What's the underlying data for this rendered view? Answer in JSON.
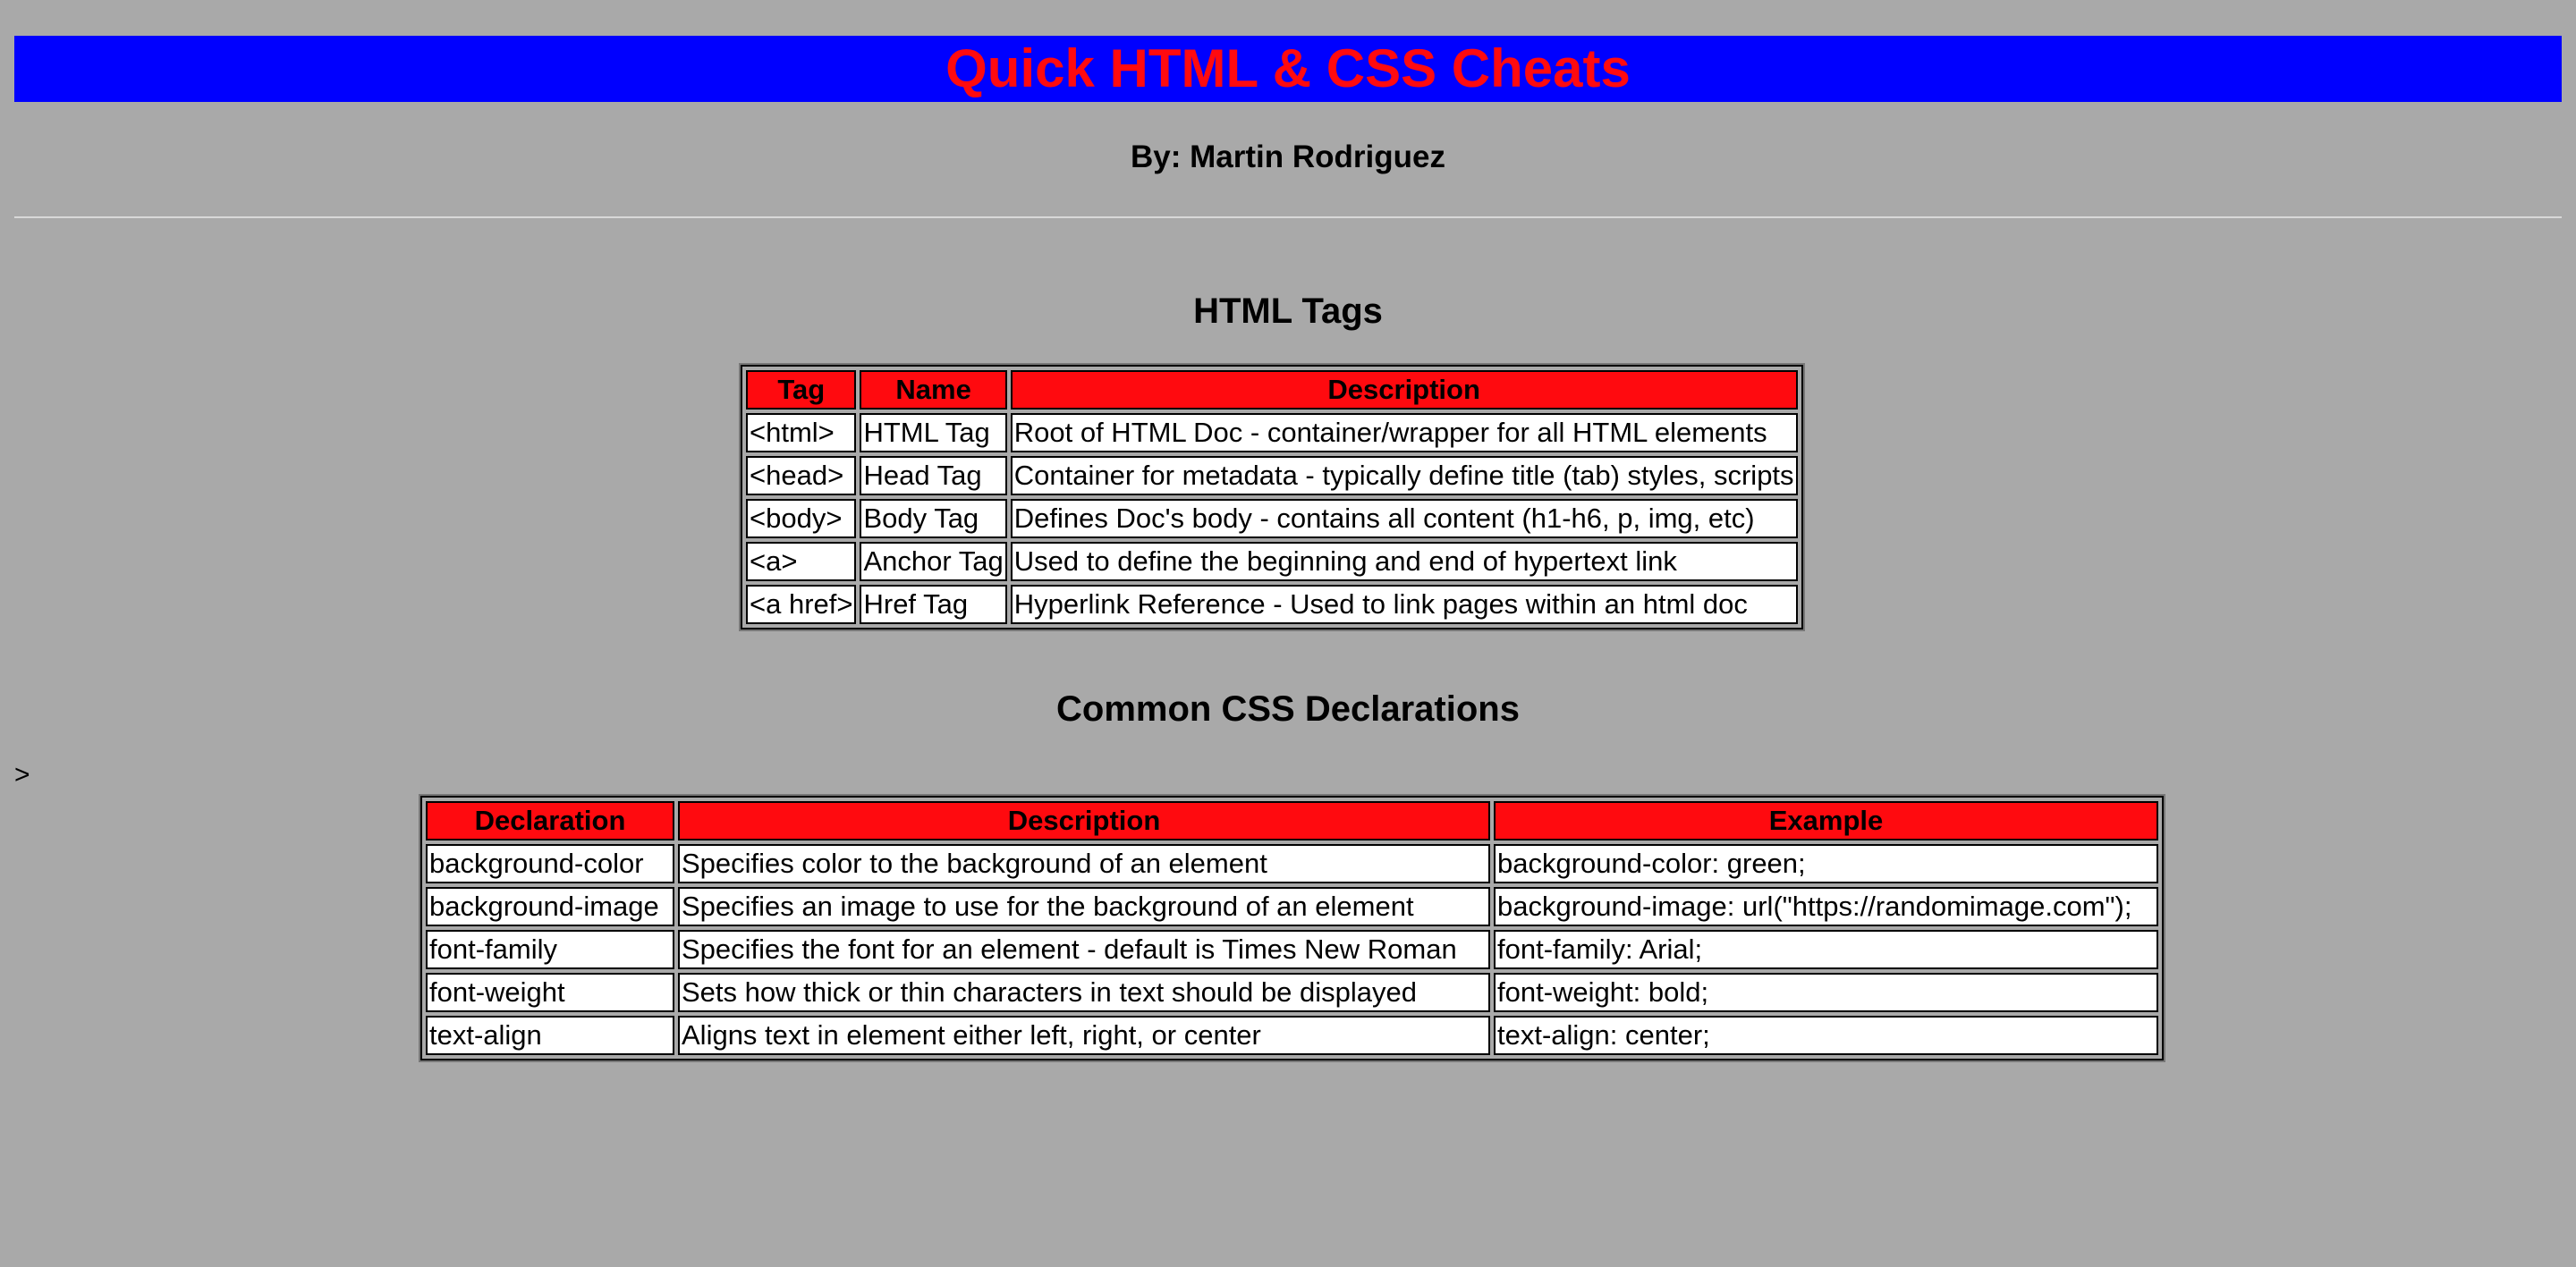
{
  "header": {
    "title": "Quick HTML & CSS Cheats",
    "byline": "By: Martin Rodriguez"
  },
  "colors": {
    "background": "#a9a9a9",
    "banner": "#0000ff",
    "title": "#ff0a0f",
    "table_header": "#ff0a0f"
  },
  "html_tags": {
    "heading": "HTML Tags",
    "columns": [
      "Tag",
      "Name",
      "Description"
    ],
    "rows": [
      [
        "<html>",
        "HTML Tag",
        "Root of HTML Doc - container/wrapper for all HTML elements"
      ],
      [
        "<head>",
        "Head Tag",
        "Container for metadata - typically define title (tab) styles, scripts"
      ],
      [
        "<body>",
        "Body Tag",
        "Defines Doc's body - contains all content (h1-h6, p, img, etc)"
      ],
      [
        "<a>",
        "Anchor Tag",
        "Used to define the beginning and end of hypertext link"
      ],
      [
        "<a href>",
        "Href Tag",
        "Hyperlink Reference - Used to link pages within an html doc"
      ]
    ]
  },
  "stray_text": ">",
  "css_declarations": {
    "heading": "Common CSS Declarations",
    "columns": [
      "Declaration",
      "Description",
      "Example"
    ],
    "rows": [
      [
        "background-color",
        "Specifies color to the background of an element",
        "background-color: green;"
      ],
      [
        "background-image",
        "Specifies an image to use for the background of an element",
        "background-image: url(\"https://randomimage.com\");"
      ],
      [
        "font-family",
        "Specifies the font for an element - default is Times New Roman",
        "font-family: Arial;"
      ],
      [
        "font-weight",
        "Sets how thick or thin characters in text should be displayed",
        "font-weight: bold;"
      ],
      [
        "text-align",
        "Aligns text in element either left, right, or center",
        "text-align: center;"
      ]
    ]
  }
}
